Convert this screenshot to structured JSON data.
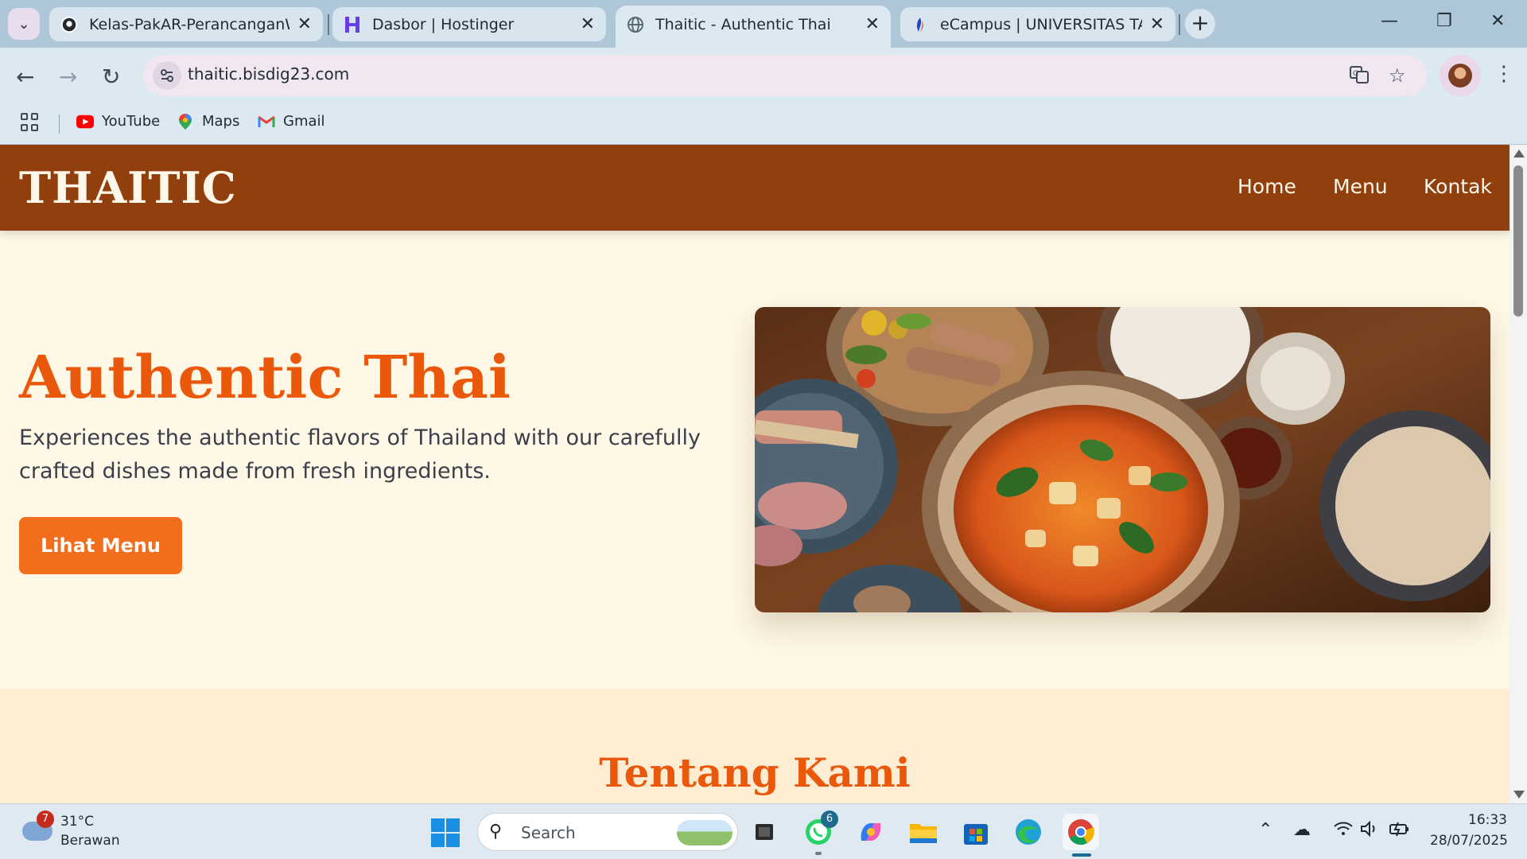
{
  "browser": {
    "tabs": [
      {
        "title": "Kelas-PakAR-PerancanganWebI",
        "favicon": "github-icon",
        "active": false
      },
      {
        "title": "Dasbor | Hostinger",
        "favicon": "hostinger-icon",
        "active": false
      },
      {
        "title": "Thaitic - Authentic Thai",
        "favicon": "globe-icon",
        "active": true
      },
      {
        "title": "eCampus | UNIVERSITAS TANGE",
        "favicon": "ecampus-icon",
        "active": false
      }
    ],
    "url": "thaitic.bisdig23.com",
    "bookmarks": [
      {
        "label": "YouTube",
        "icon": "youtube-icon"
      },
      {
        "label": "Maps",
        "icon": "maps-icon"
      },
      {
        "label": "Gmail",
        "icon": "gmail-icon"
      }
    ]
  },
  "site": {
    "brand": "THAITIC",
    "nav": [
      "Home",
      "Menu",
      "Kontak"
    ],
    "hero": {
      "title": "Authentic Thai",
      "description": "Experiences the authentic flavors of Thailand with our carefully crafted dishes made from fresh ingredients.",
      "button": "Lihat Menu"
    },
    "section_title": "Tentang Kami",
    "colors": {
      "header": "#91400d",
      "accent": "#ea580c",
      "button": "#f26d1c",
      "background": "#fff8e6",
      "section_background": "#ffedd3"
    }
  },
  "taskbar": {
    "weather": {
      "temp": "31°C",
      "desc": "Berawan",
      "badge": "7"
    },
    "search_placeholder": "Search",
    "whatsapp_badge": "6",
    "time": "16:33",
    "date": "28/07/2025"
  }
}
